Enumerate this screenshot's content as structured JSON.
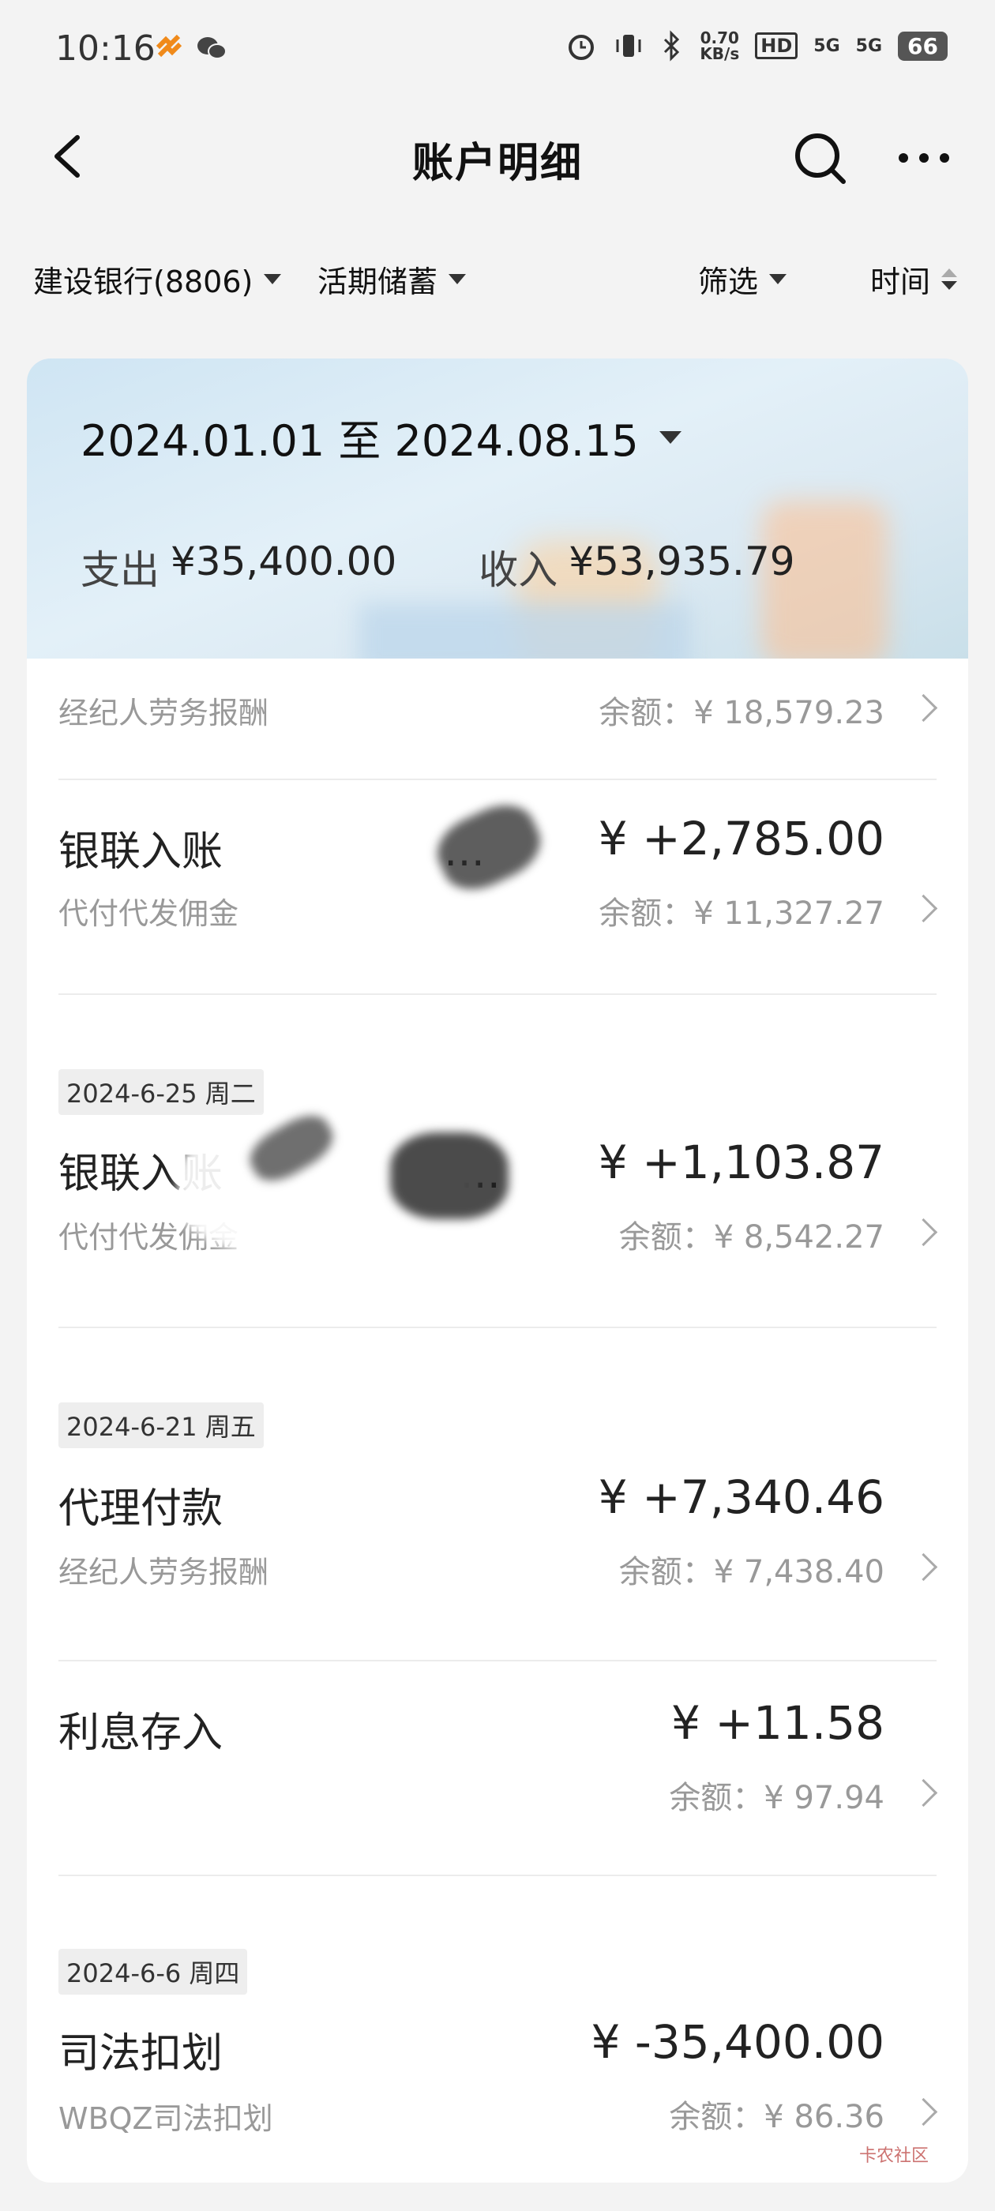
{
  "status_bar": {
    "time": "10:16",
    "net_speed": "0.70",
    "net_unit": "KB/s",
    "hd": "HD",
    "sig1": "5G",
    "sig2": "5G",
    "battery": "66",
    "icons": [
      "alarm-icon",
      "vibrate-icon",
      "bluetooth-icon",
      "signal-icon",
      "battery-icon"
    ]
  },
  "header": {
    "title": "账户明细"
  },
  "filters": {
    "bank": "建设银行(8806)",
    "account_type": "活期储蓄",
    "filter": "筛选",
    "sort": "时间"
  },
  "summary": {
    "range": "2024.01.01 至 2024.08.15",
    "expense_label": "支出",
    "expense": "¥35,400.00",
    "income_label": "收入",
    "income": "¥53,935.79"
  },
  "transactions": [
    {
      "title": "",
      "subtitle": "经纪人劳务报酬",
      "amount": "",
      "balance": "余额：¥ 18,579.23"
    },
    {
      "title": "银联入账",
      "title_suffix": "…",
      "subtitle": "代付代发佣金",
      "amount": "¥ +2,785.00",
      "balance": "余额：¥ 11,327.27"
    },
    {
      "date": "2024-6-25 周二",
      "title": "银联入账",
      "title_suffix": "…",
      "subtitle": "代付代发佣金",
      "amount": "¥ +1,103.87",
      "balance": "余额：¥ 8,542.27"
    },
    {
      "date": "2024-6-21 周五",
      "title": "代理付款",
      "subtitle": "经纪人劳务报酬",
      "amount": "¥ +7,340.46",
      "balance": "余额：¥ 7,438.40"
    },
    {
      "title": "利息存入",
      "subtitle": "",
      "amount": "¥ +11.58",
      "balance": "余额：¥ 97.94"
    },
    {
      "date": "2024-6-6 周四",
      "title": "司法扣划",
      "subtitle": "WBQZ司法扣划",
      "amount": "¥ -35,400.00",
      "balance": "余额：¥ 86.36"
    }
  ],
  "watermark": "卡农社区"
}
